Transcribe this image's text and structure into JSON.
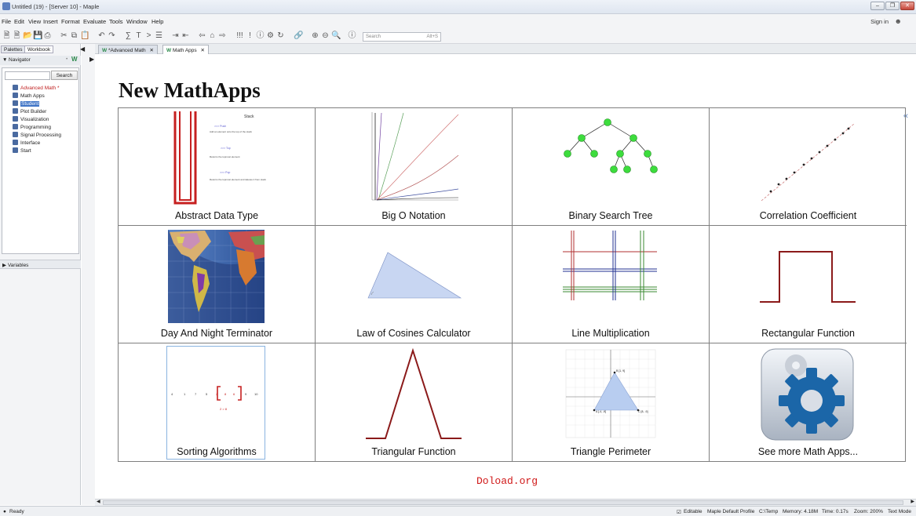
{
  "window": {
    "title": "Untitled (19) - [Server 10] - Maple"
  },
  "menu": [
    "File",
    "Edit",
    "View",
    "Insert",
    "Format",
    "Evaluate",
    "Tools",
    "Window",
    "Help"
  ],
  "signin": "Sign in",
  "toolbar": {
    "search_placeholder": "Search",
    "search_shortcut": "Alt+S"
  },
  "left_panel": {
    "tabs": [
      "Palettes",
      "Workbook"
    ],
    "navigator_label": "Navigator",
    "search_button": "Search",
    "items": [
      "Advanced Math *",
      "Math Apps",
      "Student",
      "Plot Builder",
      "Visualization",
      "Programming",
      "Signal Processing",
      "Interface",
      "Start"
    ],
    "variables_label": "Variables"
  },
  "doc_tabs": [
    "*Advanced Math",
    "Math Apps"
  ],
  "document": {
    "title": "New MathApps",
    "apps": [
      "Abstract Data Type",
      "Big O Notation",
      "Binary Search Tree",
      "Correlation Coefficient",
      "Day And Night Terminator",
      "Law of Cosines Calculator",
      "Line Multiplication",
      "Rectangular Function",
      "Sorting Algorithms",
      "Triangular Function",
      "Triangle Perimeter",
      "See more Math Apps..."
    ],
    "stack_thumb": {
      "title": "Stack",
      "push": ">>> Push",
      "push_desc": "Add an element onto the top of the stack",
      "top": ">>> Top",
      "top_desc": "Returns the topmost element",
      "pop": ">>> Pop",
      "pop_desc": "Returns the topmost element and deletes it from stack"
    },
    "sorting_thumb": {
      "numbers": [
        "4",
        "1",
        "7",
        "5",
        "2",
        "8",
        "6",
        "9",
        "10"
      ],
      "comparison": "2 > 8"
    },
    "triangle_thumb": {
      "a": "A [-4, -9]",
      "b": "B [1, 9]",
      "c": "C [8, -9]"
    },
    "watermark": "Doload.org"
  },
  "colors": {
    "accent_red": "#8b1a1a",
    "tree_node": "#3ddc3d",
    "gear_blue": "#1b66a8"
  },
  "status": {
    "ready": "Ready",
    "editable": "Editable",
    "profile": "Maple Default Profile",
    "path": "C:\\Temp",
    "memory": "Memory: 4.18M",
    "time": "Time: 0.17s",
    "zoom": "Zoom: 200%",
    "mode": "Text Mode"
  }
}
